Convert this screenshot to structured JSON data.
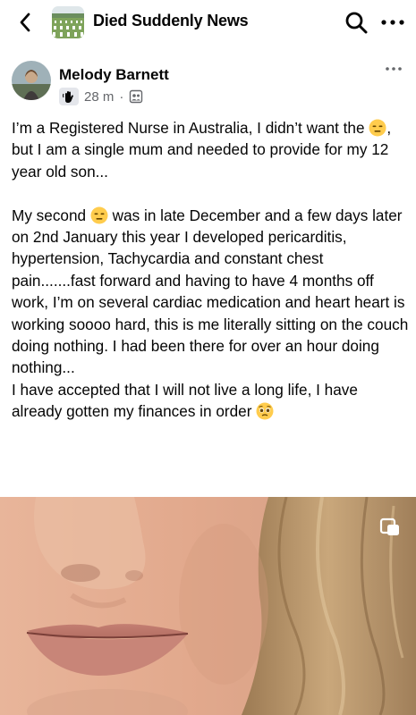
{
  "header": {
    "back_icon": "chevron-left-icon",
    "group_name": "Died Suddenly News",
    "search_icon": "search-icon",
    "more_icon": "more-horizontal-icon"
  },
  "post": {
    "author": "Melody Barnett",
    "time": "28 m",
    "separator": "·",
    "badge_icon": "waving-hand-icon",
    "audience_icon": "group-audience-icon",
    "more_icon": "more-horizontal-icon",
    "paragraphs": [
      {
        "segments": [
          "I’m a Registered Nurse in Australia, I didn’t want the ",
          ", but I am a single mum and needed to provide for my 12 year old son..."
        ],
        "emoji": "😑"
      },
      {
        "segments": [
          "My second ",
          " was in late December and a few days later on 2nd January this year I developed pericarditis, hypertension, Tachycardia and constant chest pain.......fast forward and having to have 4 months off work, I’m on several cardiac medication and heart heart is working soooo hard, this is me literally sitting on the couch doing nothing. I had been there for over an hour doing nothing..."
        ],
        "emoji": "😑"
      },
      {
        "segments": [
          "I have accepted that I will not live a long life, I have already gotten my finances in order ",
          ""
        ],
        "emoji": "🥺"
      }
    ]
  },
  "photo": {
    "subject": "close-up-face-photo",
    "overlay_icon": "multi-photo-icon"
  }
}
